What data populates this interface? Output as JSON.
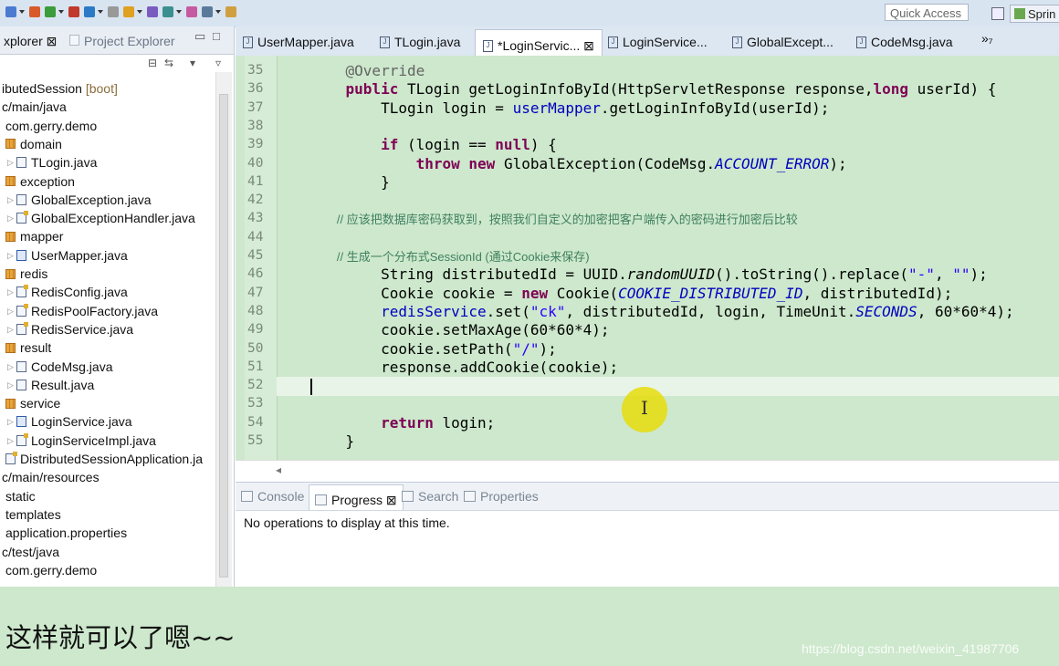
{
  "toolbar": {
    "quick_access": "Quick Access",
    "perspective": "Sprin",
    "icon_colors": [
      "#4a7bd0",
      "#d85a2a",
      "#3a9c3a",
      "#c0392b",
      "#2b7ac7",
      "#999999",
      "#e0a020",
      "#7a5cc0",
      "#3c8f8f",
      "#c65aa0",
      "#5a7a9a",
      "#d0a040"
    ]
  },
  "explorer": {
    "tab_active": "xplorer ⊠",
    "tab_inactive": "Project Explorer",
    "items": [
      {
        "label": "ibutedSession [boot]",
        "indent": 0,
        "icon": "none",
        "suffix_color": "#8a6d3b"
      },
      {
        "label": "c/main/java",
        "indent": 0,
        "icon": "none"
      },
      {
        "label": "com.gerry.demo",
        "indent": 1,
        "icon": "none"
      },
      {
        "label": "domain",
        "indent": 1,
        "icon": "pkg"
      },
      {
        "label": "TLogin.java",
        "indent": 2,
        "icon": "java",
        "twisty": true
      },
      {
        "label": "exception",
        "indent": 1,
        "icon": "pkg"
      },
      {
        "label": "GlobalException.java",
        "indent": 2,
        "icon": "java",
        "twisty": true
      },
      {
        "label": "GlobalExceptionHandler.java",
        "indent": 2,
        "icon": "mod",
        "twisty": true
      },
      {
        "label": "mapper",
        "indent": 1,
        "icon": "pkg"
      },
      {
        "label": "UserMapper.java",
        "indent": 2,
        "icon": "edit",
        "twisty": true
      },
      {
        "label": "redis",
        "indent": 1,
        "icon": "pkg"
      },
      {
        "label": "RedisConfig.java",
        "indent": 2,
        "icon": "mod",
        "twisty": true
      },
      {
        "label": "RedisPoolFactory.java",
        "indent": 2,
        "icon": "mod",
        "twisty": true
      },
      {
        "label": "RedisService.java",
        "indent": 2,
        "icon": "mod",
        "twisty": true
      },
      {
        "label": "result",
        "indent": 1,
        "icon": "pkg"
      },
      {
        "label": "CodeMsg.java",
        "indent": 2,
        "icon": "java",
        "twisty": true
      },
      {
        "label": "Result.java",
        "indent": 2,
        "icon": "java",
        "twisty": true
      },
      {
        "label": "service",
        "indent": 1,
        "icon": "pkg"
      },
      {
        "label": "LoginService.java",
        "indent": 2,
        "icon": "edit",
        "twisty": true
      },
      {
        "label": "LoginServiceImpl.java",
        "indent": 2,
        "icon": "mod",
        "twisty": true
      },
      {
        "label": "DistributedSessionApplication.ja",
        "indent": 1,
        "icon": "mod"
      },
      {
        "label": "c/main/resources",
        "indent": 0,
        "icon": "none"
      },
      {
        "label": "static",
        "indent": 1,
        "icon": "none"
      },
      {
        "label": "templates",
        "indent": 1,
        "icon": "none"
      },
      {
        "label": "application.properties",
        "indent": 1,
        "icon": "none"
      },
      {
        "label": "c/test/java",
        "indent": 0,
        "icon": "none"
      },
      {
        "label": "com.gerry.demo",
        "indent": 1,
        "icon": "none"
      }
    ]
  },
  "editor": {
    "tabs": [
      {
        "label": "UserMapper.java",
        "active": false
      },
      {
        "label": "TLogin.java",
        "active": false
      },
      {
        "label": "*LoginServic... ⊠",
        "active": true
      },
      {
        "label": "LoginService...",
        "active": false
      },
      {
        "label": "GlobalExcept...",
        "active": false
      },
      {
        "label": "CodeMsg.java",
        "active": false
      }
    ],
    "more_tabs": "»₇",
    "line_numbers": [
      "35",
      "36",
      "37",
      "38",
      "39",
      "40",
      "41",
      "42",
      "43",
      "44",
      "45",
      "46",
      "47",
      "48",
      "49",
      "50",
      "51",
      "52",
      "53",
      "54",
      "55"
    ],
    "lines": [
      [
        {
          "t": "    "
        },
        {
          "t": "@Override",
          "c": "ann"
        }
      ],
      [
        {
          "t": "    "
        },
        {
          "t": "public",
          "c": "kw"
        },
        {
          "t": " TLogin getLoginInfoById(HttpServletResponse response,"
        },
        {
          "t": "long",
          "c": "kw"
        },
        {
          "t": " userId) {"
        }
      ],
      [
        {
          "t": "        TLogin login = "
        },
        {
          "t": "userMapper",
          "c": "fld"
        },
        {
          "t": ".getLoginInfoById(userId);"
        }
      ],
      [],
      [
        {
          "t": "        "
        },
        {
          "t": "if",
          "c": "kw"
        },
        {
          "t": " (login == "
        },
        {
          "t": "null",
          "c": "kw"
        },
        {
          "t": ") {"
        }
      ],
      [
        {
          "t": "            "
        },
        {
          "t": "throw",
          "c": "kw"
        },
        {
          "t": " "
        },
        {
          "t": "new",
          "c": "kw"
        },
        {
          "t": " GlobalException(CodeMsg."
        },
        {
          "t": "ACCOUNT_ERROR",
          "c": "sfld"
        },
        {
          "t": ");"
        }
      ],
      [
        {
          "t": "        }"
        }
      ],
      [],
      [
        {
          "t": "        // 应该把数据库密码获取到，按照我们自定义的加密把客户端传入的密码进行加密后比较",
          "c": "cm"
        }
      ],
      [],
      [
        {
          "t": "        // 生成一个分布式SessionId (通过Cookie来保存)",
          "c": "cm"
        }
      ],
      [
        {
          "t": "        String distributedId = UUID."
        },
        {
          "t": "randomUUID",
          "c": "it"
        },
        {
          "t": "().toString().replace("
        },
        {
          "t": "\"-\"",
          "c": "str"
        },
        {
          "t": ", "
        },
        {
          "t": "\"\"",
          "c": "str"
        },
        {
          "t": ");"
        }
      ],
      [
        {
          "t": "        Cookie cookie = "
        },
        {
          "t": "new",
          "c": "kw"
        },
        {
          "t": " Cookie("
        },
        {
          "t": "COOKIE_DISTRIBUTED_ID",
          "c": "sfld"
        },
        {
          "t": ", distributedId);"
        }
      ],
      [
        {
          "t": "        "
        },
        {
          "t": "redisService",
          "c": "fld"
        },
        {
          "t": ".set("
        },
        {
          "t": "\"ck\"",
          "c": "str"
        },
        {
          "t": ", distributedId, login, TimeUnit."
        },
        {
          "t": "SECONDS",
          "c": "sfld"
        },
        {
          "t": ", 60*60*4);"
        }
      ],
      [
        {
          "t": "        cookie.setMaxAge(60*60*4);"
        }
      ],
      [
        {
          "t": "        cookie.setPath("
        },
        {
          "t": "\"/\"",
          "c": "str"
        },
        {
          "t": ");"
        }
      ],
      [
        {
          "t": "        response.addCookie(cookie);"
        }
      ],
      [],
      [],
      [
        {
          "t": "        "
        },
        {
          "t": "return",
          "c": "kw"
        },
        {
          "t": " login;"
        }
      ],
      [
        {
          "t": "    }"
        }
      ]
    ]
  },
  "panel": {
    "tabs": [
      {
        "label": "Console",
        "active": false
      },
      {
        "label": "Progress ⊠",
        "active": true
      },
      {
        "label": "Search",
        "active": false
      },
      {
        "label": "Properties",
        "active": false
      }
    ],
    "message": "No operations to display at this time."
  },
  "caption": "这样就可以了嗯~~",
  "watermark": "https://blog.csdn.net/weixin_41987706"
}
